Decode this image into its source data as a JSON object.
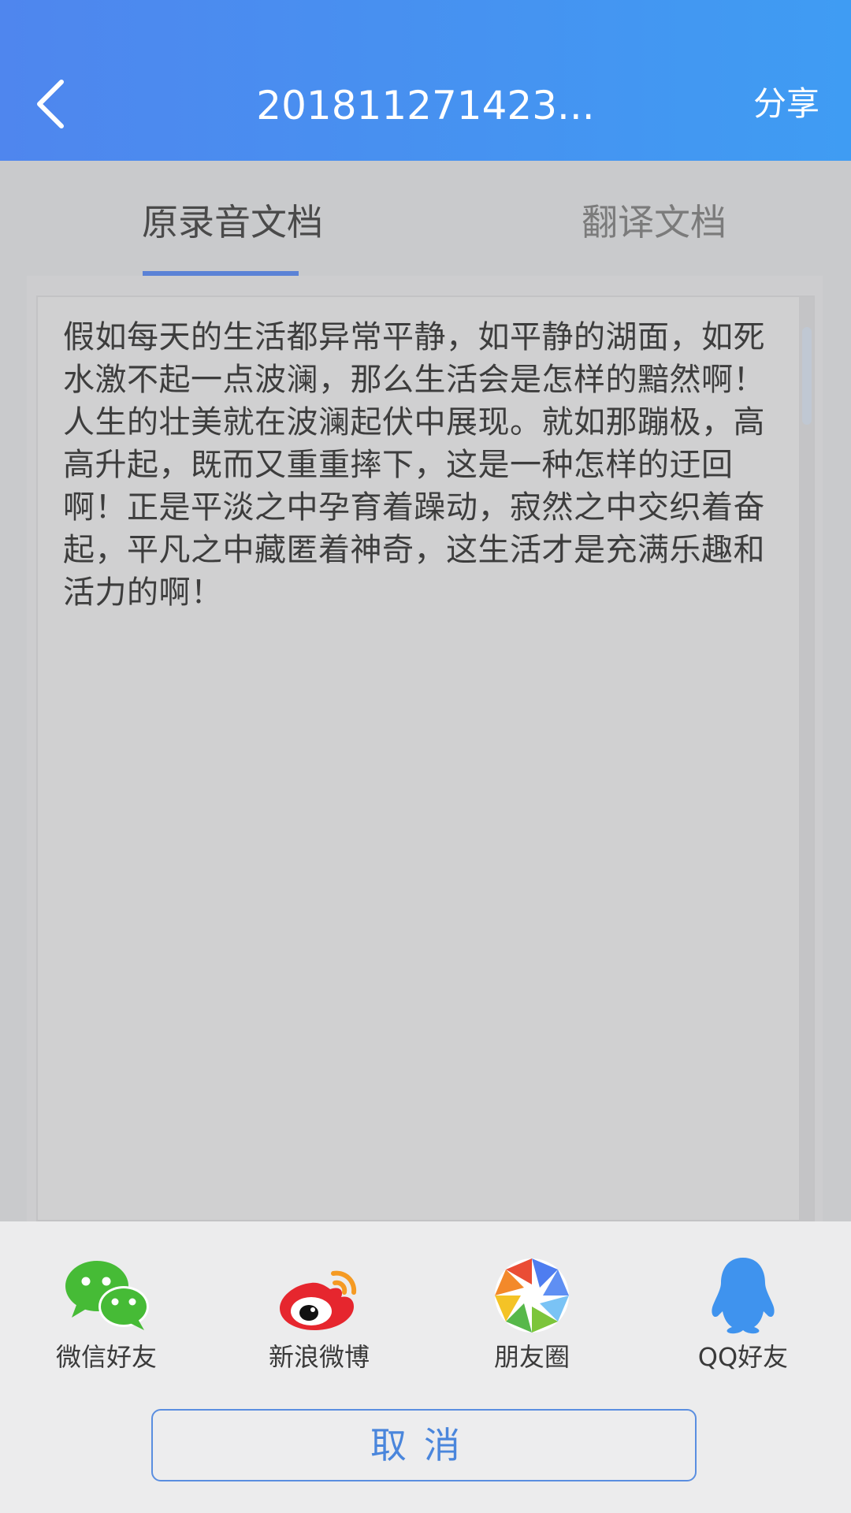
{
  "header": {
    "title": "201811271423...",
    "share_label": "分享",
    "back_icon": "chevron-left-icon"
  },
  "tabs": [
    {
      "label": "原录音文档",
      "active": true
    },
    {
      "label": "翻译文档",
      "active": false
    }
  ],
  "document": {
    "text": "假如每天的生活都异常平静，如平静的湖面，如死水激不起一点波澜，那么生活会是怎样的黯然啊！人生的壮美就在波澜起伏中展现。就如那蹦极，高高升起，既而又重重摔下，这是一种怎样的迂回啊！正是平淡之中孕育着躁动，寂然之中交织着奋起，平凡之中藏匿着神奇，这生活才是充满乐趣和活力的啊！"
  },
  "share_sheet": {
    "items": [
      {
        "label": "微信好友",
        "icon": "wechat-icon"
      },
      {
        "label": "新浪微博",
        "icon": "weibo-icon"
      },
      {
        "label": "朋友圈",
        "icon": "moments-icon"
      },
      {
        "label": "QQ好友",
        "icon": "qq-icon"
      }
    ],
    "cancel_label": "取消"
  },
  "colors": {
    "header_start": "#4f86ee",
    "header_end": "#3f9cf3",
    "accent": "#5b82d6",
    "cancel_text": "#4a86dc"
  }
}
